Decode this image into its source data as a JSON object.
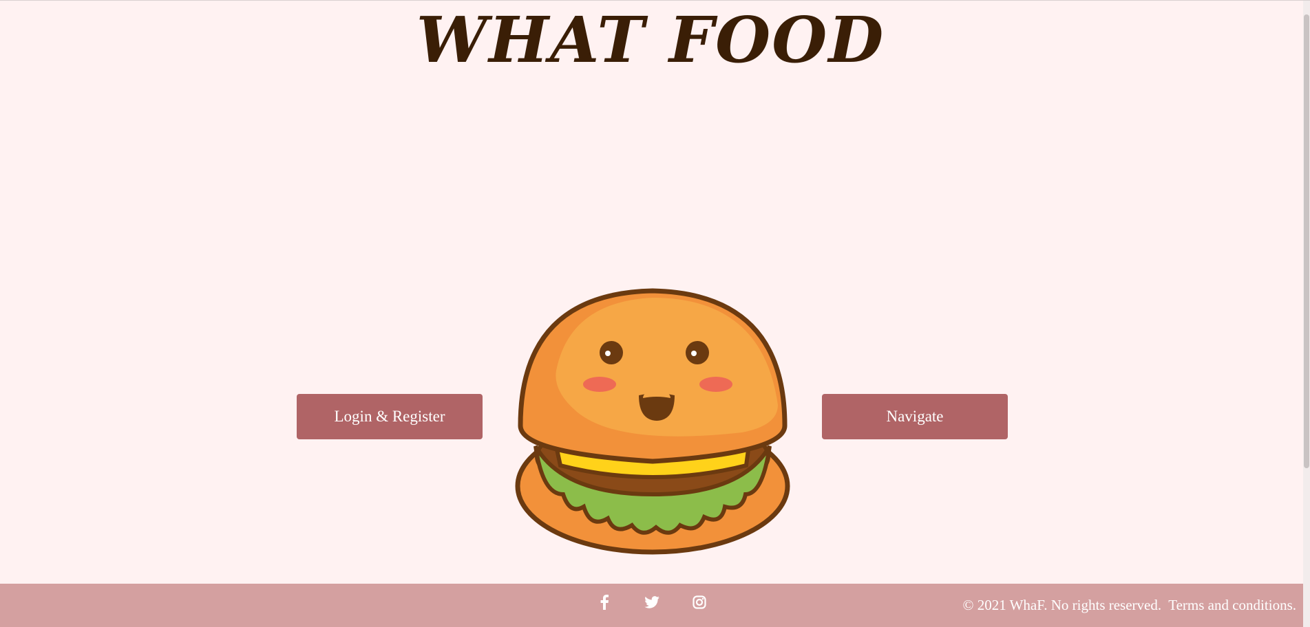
{
  "header": {
    "title": "WHAT FOOD"
  },
  "main": {
    "login_button_label": "Login & Register",
    "navigate_button_label": "Navigate",
    "mascot_icon": "hamburger-mascot"
  },
  "footer": {
    "social_icons": [
      "facebook-icon",
      "twitter-icon",
      "instagram-icon"
    ],
    "copyright": "© 2021 WhaF. No rights reserved.  Terms and conditions."
  },
  "colors": {
    "background": "#fff2f2",
    "title": "#3a1e06",
    "button": "#b06466",
    "footer": "#d4a0a0"
  }
}
